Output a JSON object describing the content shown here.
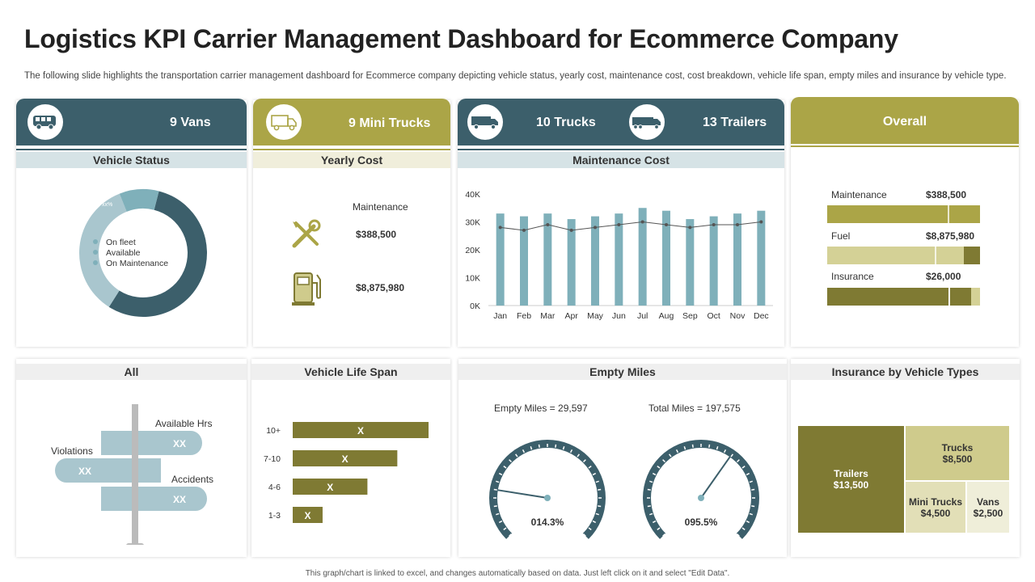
{
  "title": "Logistics KPI Carrier Management Dashboard for Ecommerce Company",
  "subtitle": "The following slide highlights the transportation carrier management dashboard for Ecommerce company depicting vehicle status, yearly cost, maintenance cost, cost breakdown, vehicle life span, empty miles and  insurance by vehicle type.",
  "footer": "This graph/chart is linked to excel, and changes automatically based on data. Just left click on it and select \"Edit Data\".",
  "colors": {
    "teal_dark": "#3c5f6b",
    "olive": "#aba547",
    "olive_dark": "#7f7a33",
    "olive_light": "#cfcb8c",
    "teal_light": "#9cc3cc",
    "bar_teal": "#7fb0ba"
  },
  "vans": {
    "label": "9 Vans",
    "icon": "van-icon"
  },
  "mini_trucks": {
    "label": "9 Mini  Trucks",
    "icon": "mini-truck-icon"
  },
  "trucks": {
    "label": "10 Trucks",
    "icon": "truck-icon"
  },
  "trailers": {
    "label": "13 Trailers",
    "icon": "trailer-icon"
  },
  "overall": {
    "label": "Overall"
  },
  "vehicle_status": {
    "heading": "Vehicle Status",
    "legend": [
      "On fleet",
      "Available",
      "On Maintenance"
    ],
    "slice_labels": [
      "xx%",
      "xx%",
      "xx%"
    ]
  },
  "yearly_cost": {
    "heading": "Yearly Cost",
    "maintenance_label": "Maintenance",
    "maintenance_value": "$388,500",
    "fuel_value": "$8,875,980",
    "icons": [
      "tools-icon",
      "fuel-pump-icon"
    ]
  },
  "overall_costs": [
    {
      "name": "Maintenance",
      "value": "$388,500"
    },
    {
      "name": "Fuel",
      "value": "$8,875,980"
    },
    {
      "name": "Insurance",
      "value": "$26,000"
    }
  ],
  "all_panel": {
    "heading": "All",
    "available_label": "Available Hrs",
    "violations_label": "Violations",
    "accidents_label": "Accidents",
    "available_value": "XX",
    "violations_value": "XX",
    "accidents_value": "XX"
  },
  "life_span": {
    "heading": "Vehicle Life Span",
    "rows": [
      {
        "label": "10+",
        "text": "X",
        "value": 100
      },
      {
        "label": "7-10",
        "text": "X",
        "value": 77
      },
      {
        "label": "4-6",
        "text": "X",
        "value": 55
      },
      {
        "label": "1-3",
        "text": "X",
        "value": 22
      }
    ]
  },
  "empty_miles": {
    "heading": "Empty Miles",
    "empty_label": "Empty Miles = 29,597",
    "total_label": "Total Miles = 197,575",
    "gauge1_value": "014.3%",
    "gauge2_value": "095.5%"
  },
  "insurance": {
    "heading": "Insurance by Vehicle Types",
    "cells": [
      {
        "name": "Trailers",
        "value": "$13,500"
      },
      {
        "name": "Trucks",
        "value": "$8,500"
      },
      {
        "name": "Mini Trucks",
        "value": "$4,500"
      },
      {
        "name": "Vans",
        "value": "$2,500"
      }
    ]
  },
  "chart_data": [
    {
      "type": "bar",
      "title": "Maintenance Cost",
      "categories": [
        "Jan",
        "Feb",
        "Mar",
        "Apr",
        "May",
        "Jun",
        "Jul",
        "Aug",
        "Sep",
        "Oct",
        "Nov",
        "Dec"
      ],
      "series": [
        {
          "type": "bar",
          "values": [
            33000,
            32000,
            33000,
            31000,
            32000,
            33000,
            35000,
            34000,
            31000,
            32000,
            33000,
            34000
          ]
        },
        {
          "type": "line",
          "values": [
            28000,
            27000,
            29000,
            27000,
            28000,
            29000,
            30000,
            29000,
            28000,
            29000,
            29000,
            30000
          ]
        }
      ],
      "y_ticks": [
        "0K",
        "10K",
        "20K",
        "30K",
        "40K"
      ],
      "ylim": [
        0,
        40000
      ],
      "grid": false
    },
    {
      "type": "pie",
      "title": "Vehicle Status",
      "categories": [
        "On fleet",
        "Available",
        "On Maintenance"
      ],
      "values": [
        55,
        35,
        10
      ]
    },
    {
      "type": "bar",
      "title": "Vehicle Life Span",
      "orientation": "horizontal",
      "categories": [
        "10+",
        "7-10",
        "4-6",
        "1-3"
      ],
      "values": [
        100,
        77,
        55,
        22
      ]
    }
  ]
}
